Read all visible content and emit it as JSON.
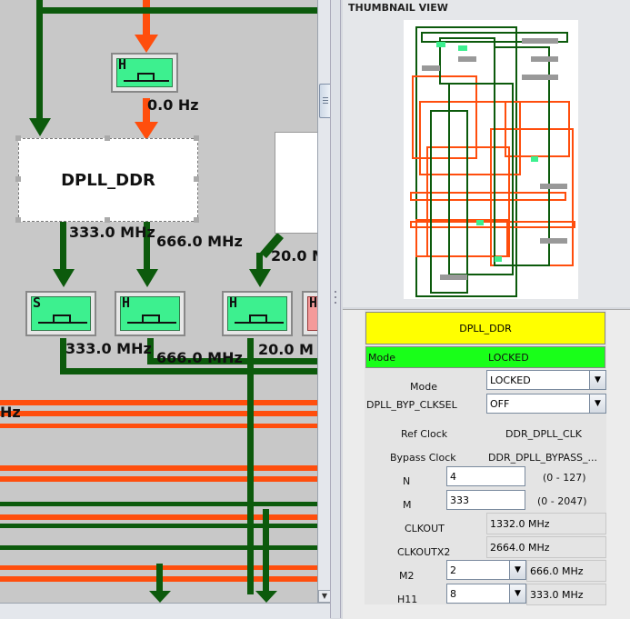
{
  "canvas": {
    "blocks": {
      "main_block_label": "DPLL_DDR"
    },
    "clock_boxes": [
      {
        "letter": "H"
      },
      {
        "letter": "S"
      },
      {
        "letter": "H"
      },
      {
        "letter": "H"
      },
      {
        "letter": "H"
      }
    ],
    "freq_labels": [
      "0.0 Hz",
      "333.0 MHz",
      "666.0 MHz",
      "20.0 M",
      "333.0 MHz",
      "666.0 MHz",
      "20.0 M",
      "Hz"
    ],
    "colors": {
      "orange": "#ff4e0d",
      "green": "#0c5a0c",
      "clock_green": "#3df08f",
      "clock_red": "#f49a9a"
    }
  },
  "thumbnail": {
    "title": "THUMBNAIL VIEW"
  },
  "props": {
    "title": "DPLL_DDR",
    "mode_row": {
      "label": "Mode",
      "value": "LOCKED"
    },
    "mode": {
      "label": "Mode",
      "value": "LOCKED"
    },
    "byp": {
      "label": "DPLL_BYP_CLKSEL",
      "value": "OFF"
    },
    "ref_clock": {
      "label": "Ref Clock",
      "value": "DDR_DPLL_CLK"
    },
    "bypass_clock": {
      "label": "Bypass Clock",
      "value": "DDR_DPLL_BYPASS_..."
    },
    "n": {
      "label": "N",
      "value": "4",
      "range": "(0 - 127)"
    },
    "m": {
      "label": "M",
      "value": "333",
      "range": "(0 - 2047)"
    },
    "clkout": {
      "label": "CLKOUT",
      "value": "1332.0 MHz"
    },
    "clkoutx2": {
      "label": "CLKOUTX2",
      "value": "2664.0 MHz"
    },
    "m2": {
      "label": "M2",
      "value": "2",
      "freq": "666.0 MHz"
    },
    "h11": {
      "label": "H11",
      "value": "8",
      "freq": "333.0 MHz"
    }
  }
}
